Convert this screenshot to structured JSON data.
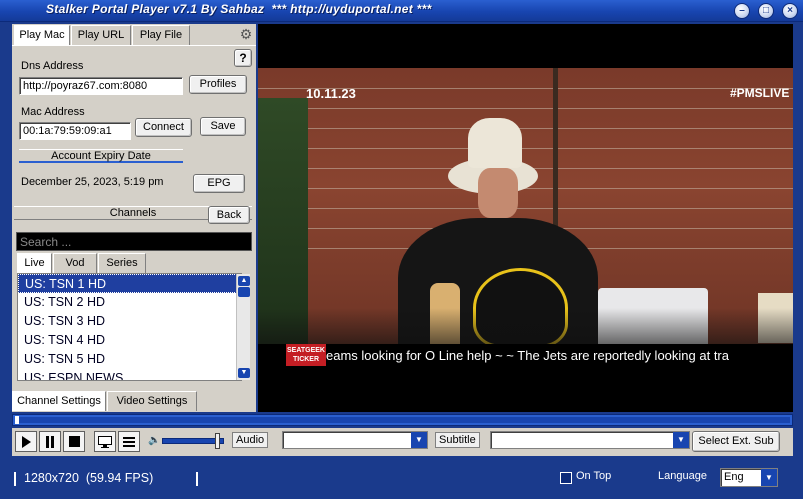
{
  "window": {
    "title": "Stalker Portal Player v7.1 By Sahbaz",
    "subtitle": "*** http://uyduportal.net ***"
  },
  "left": {
    "tabs": [
      "Play Mac",
      "Play URL",
      "Play File"
    ],
    "help_label": "?",
    "dns_label": "Dns Address",
    "dns_value": "http://poyraz67.com:8080",
    "profiles_label": "Profiles",
    "mac_label": "Mac Address",
    "mac_value": "00:1a:79:59:09:a1",
    "connect_label": "Connect",
    "save_label": "Save",
    "expiry_header": "Account Expiry Date",
    "expiry_value": "December 25, 2023, 5:19 pm",
    "epg_label": "EPG",
    "channels_header": "Channels",
    "back_label": "Back",
    "search_placeholder": "Search ...",
    "list_tabs": [
      "Live",
      "Vod",
      "Series"
    ],
    "channels": [
      "US: TSN 1 HD",
      "US: TSN 2 HD",
      "US: TSN 3 HD",
      "US: TSN 4 HD",
      "US: TSN 5 HD",
      "US: ESPN NEWS"
    ],
    "selected_channel_index": 0,
    "bottom_tabs": [
      "Channel Settings",
      "Video Settings"
    ]
  },
  "video": {
    "date_overlay": "10.11.23",
    "hashtag_overlay": "#PMSLIVE",
    "ticker_badge": "SEATGEEK TICKER",
    "ticker_text": "eams looking for O Line help ~       ~ The Jets are reportedly looking at tra"
  },
  "controls": {
    "audio_label": "Audio",
    "subtitle_label": "Subtitle",
    "select_ext_sub_label": "Select Ext. Sub",
    "volume_level": 0.95,
    "seek_position": 0.0
  },
  "status": {
    "resolution": "1280x720",
    "fps": "(59.94 FPS)",
    "on_top_label": "On Top",
    "language_label": "Language",
    "language_value": "Eng"
  },
  "colors": {
    "chrome_blue": "#1a3a8c",
    "accent_blue": "#1845b0",
    "panel_gray": "#d4d0c8"
  }
}
